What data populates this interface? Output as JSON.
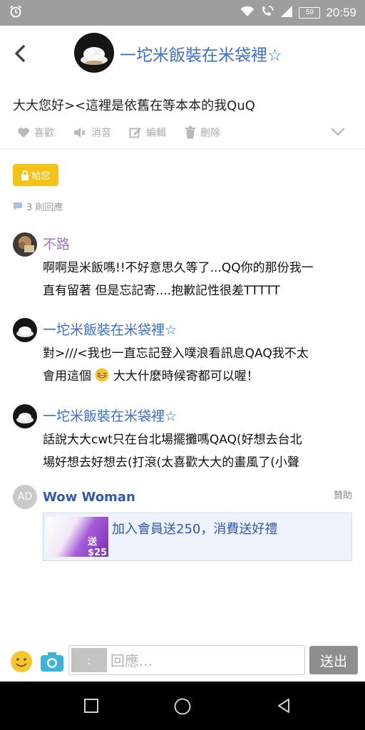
{
  "status_bar": {
    "time": "20:59",
    "battery": "59",
    "icons": [
      "alarm-icon",
      "wifi-icon",
      "wifi-call-icon",
      "signal-icon",
      "battery-icon"
    ]
  },
  "header": {
    "title": "一坨米飯裝在米袋裡☆"
  },
  "post": {
    "text": "大大您好><這裡是依舊在等本本的我QuQ",
    "actions": {
      "like": "喜歡",
      "mute": "消音",
      "edit": "編輯",
      "delete": "刪除"
    }
  },
  "gift_button": "給您",
  "reply_count": "3 則回應",
  "comments": [
    {
      "name": "不路",
      "name_color": "#a274c6",
      "line1": "啊啊是米飯嗎!!不好意思久等了...QQ你的那份我一",
      "line2": "直有留著 但是忘記寄....抱歉記性很差TTTTT"
    },
    {
      "name": "一坨米飯裝在米袋裡☆",
      "name_color": "#3b6fd0",
      "line1": "對>///<我也一直忘記登入噗浪看訊息QAQ我不太",
      "line2a": "會用這個",
      "line2b": "大大什麼時候寄都可以喔！"
    },
    {
      "name": "一坨米飯裝在米袋裡☆",
      "name_color": "#3b6fd0",
      "line1": "話說大大cwt只在台北場擺攤嗎QAQ(好想去台北",
      "line2": "場好想去好想去(打滾(太喜歡大大的畫風了(小聲"
    }
  ],
  "ad": {
    "avatar_label": "AD",
    "name": "Wow Woman",
    "sponsored_label": "贊助",
    "title": "加入會員送250，消費送好禮",
    "thumb_text": "送$25"
  },
  "composer": {
    "prefix": ":",
    "placeholder": "回應...",
    "send_label": "送出"
  },
  "colors": {
    "accent": "#3b6fd0",
    "gift": "#f5c216",
    "status_bar": "#9e9e9e"
  }
}
